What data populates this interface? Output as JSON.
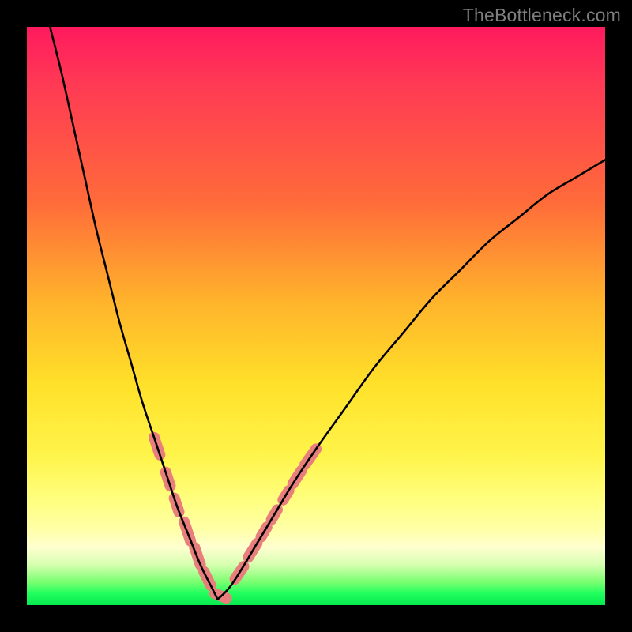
{
  "watermark": "TheBottleneck.com",
  "chart_data": {
    "type": "line",
    "title": "",
    "xlabel": "",
    "ylabel": "",
    "xlim": [
      0,
      100
    ],
    "ylim": [
      0,
      100
    ],
    "grid": false,
    "legend": false,
    "series": [
      {
        "name": "left-curve",
        "x": [
          4,
          6,
          8,
          10,
          12,
          14,
          16,
          18,
          20,
          22,
          24,
          26,
          28,
          30,
          32,
          33
        ],
        "y": [
          100,
          92,
          83,
          74,
          65,
          57,
          49,
          42,
          35,
          29,
          23,
          17,
          12,
          7,
          3,
          1
        ]
      },
      {
        "name": "right-curve",
        "x": [
          33,
          35,
          37,
          40,
          43,
          46,
          50,
          55,
          60,
          65,
          70,
          75,
          80,
          85,
          90,
          95,
          100
        ],
        "y": [
          1,
          3,
          6,
          11,
          16,
          21,
          27,
          34,
          41,
          47,
          53,
          58,
          63,
          67,
          71,
          74,
          77
        ]
      },
      {
        "name": "left-dashes",
        "segments": [
          {
            "x": [
              22.0,
              23.0
            ],
            "y": [
              29.0,
              26.0
            ]
          },
          {
            "x": [
              24.0,
              24.8
            ],
            "y": [
              23.0,
              20.6
            ]
          },
          {
            "x": [
              25.5,
              26.3
            ],
            "y": [
              18.5,
              16.1
            ]
          },
          {
            "x": [
              27.2,
              28.3
            ],
            "y": [
              14.4,
              11.1
            ]
          },
          {
            "x": [
              29.0,
              30.0
            ],
            "y": [
              10.0,
              7.0
            ]
          },
          {
            "x": [
              30.6,
              31.8
            ],
            "y": [
              5.8,
              3.4
            ]
          },
          {
            "x": [
              32.5,
              34.5
            ],
            "y": [
              2.0,
              1.2
            ]
          }
        ]
      },
      {
        "name": "right-dashes",
        "segments": [
          {
            "x": [
              36.0,
              37.5
            ],
            "y": [
              4.5,
              6.7
            ]
          },
          {
            "x": [
              38.3,
              39.8
            ],
            "y": [
              8.3,
              10.7
            ]
          },
          {
            "x": [
              40.5,
              41.5
            ],
            "y": [
              11.8,
              13.5
            ]
          },
          {
            "x": [
              42.3,
              43.3
            ],
            "y": [
              14.8,
              16.5
            ]
          },
          {
            "x": [
              44.3,
              45.3
            ],
            "y": [
              18.2,
              19.8
            ]
          },
          {
            "x": [
              46.0,
              47.5
            ],
            "y": [
              21.0,
              23.3
            ]
          },
          {
            "x": [
              48.1,
              50.0
            ],
            "y": [
              24.3,
              27.0
            ]
          }
        ]
      }
    ],
    "colors": {
      "curve": "#000000",
      "dash": "#e97f7c"
    }
  }
}
